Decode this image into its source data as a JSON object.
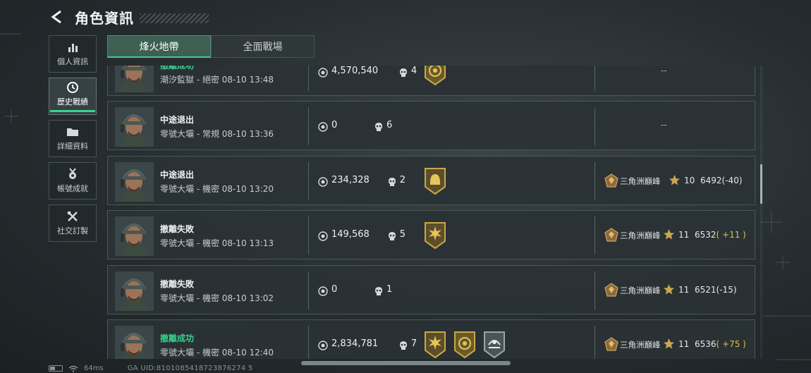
{
  "header": {
    "title": "角色資訊",
    "back_icon": "back-arrow-icon"
  },
  "sidebar": {
    "items": [
      {
        "label": "個人資訊",
        "icon": "bar-chart-icon",
        "active": false
      },
      {
        "label": "歷史戰績",
        "icon": "history-clock-icon",
        "active": true
      },
      {
        "label": "詳細資料",
        "icon": "folder-icon",
        "active": false
      },
      {
        "label": "帳號成就",
        "icon": "medal-icon",
        "active": false
      },
      {
        "label": "社交訂製",
        "icon": "tools-icon",
        "active": false
      }
    ]
  },
  "tabs": [
    {
      "label": "烽火地帶",
      "active": true
    },
    {
      "label": "全面戰場",
      "active": false
    }
  ],
  "matches": [
    {
      "status": "撤離成功",
      "result": "success",
      "detail": "潮汐監獄 - 絕密 08-10 13:48",
      "value": "4,570,540",
      "kills": "4",
      "badges": [
        "gold-coin-badge-icon"
      ],
      "rank": null,
      "dash": "--"
    },
    {
      "status": "中途退出",
      "result": "fail",
      "detail": "零號大壩 - 常規 08-10 13:36",
      "value": "0",
      "kills": "6",
      "badges": [],
      "rank": null,
      "dash": "--"
    },
    {
      "status": "中途退出",
      "result": "fail",
      "detail": "零號大壩 - 機密 08-10 13:20",
      "value": "234,328",
      "kills": "2",
      "badges": [
        "helmet-badge-icon"
      ],
      "rank": {
        "name": "三角洲巔峰",
        "level": "10",
        "score": "6492",
        "delta": "(-40)",
        "delta_type": "neg"
      }
    },
    {
      "status": "撤離失敗",
      "result": "fail",
      "detail": "零號大壩 - 機密 08-10 13:13",
      "value": "149,568",
      "kills": "5",
      "badges": [
        "burst-badge-icon"
      ],
      "rank": {
        "name": "三角洲巔峰",
        "level": "11",
        "score": "6532",
        "delta": "( +11 )",
        "delta_type": "pos"
      }
    },
    {
      "status": "撤離失敗",
      "result": "fail",
      "detail": "零號大壩 - 機密 08-10 13:02",
      "value": "0",
      "kills": "1",
      "badges": [],
      "rank": {
        "name": "三角洲巔峰",
        "level": "11",
        "score": "6521",
        "delta": "(-15)",
        "delta_type": "neg"
      }
    },
    {
      "status": "撤離成功",
      "result": "success",
      "detail": "零號大壩 - 機密 08-10 12:40",
      "value": "2,834,781",
      "kills": "7",
      "badges": [
        "burst-badge-icon",
        "gold-coin-badge-icon",
        "rescue-badge-icon"
      ],
      "rank": {
        "name": "三角洲巔峰",
        "level": "11",
        "score": "6536",
        "delta": "( +75 )",
        "delta_type": "pos"
      }
    }
  ],
  "statusbar": {
    "ping": "64ms",
    "uid": "GA UID:8101085418723876274 5"
  },
  "colors": {
    "accent": "#38d48f",
    "gold": "#e1c04d",
    "row_bg": "#2a3235"
  }
}
